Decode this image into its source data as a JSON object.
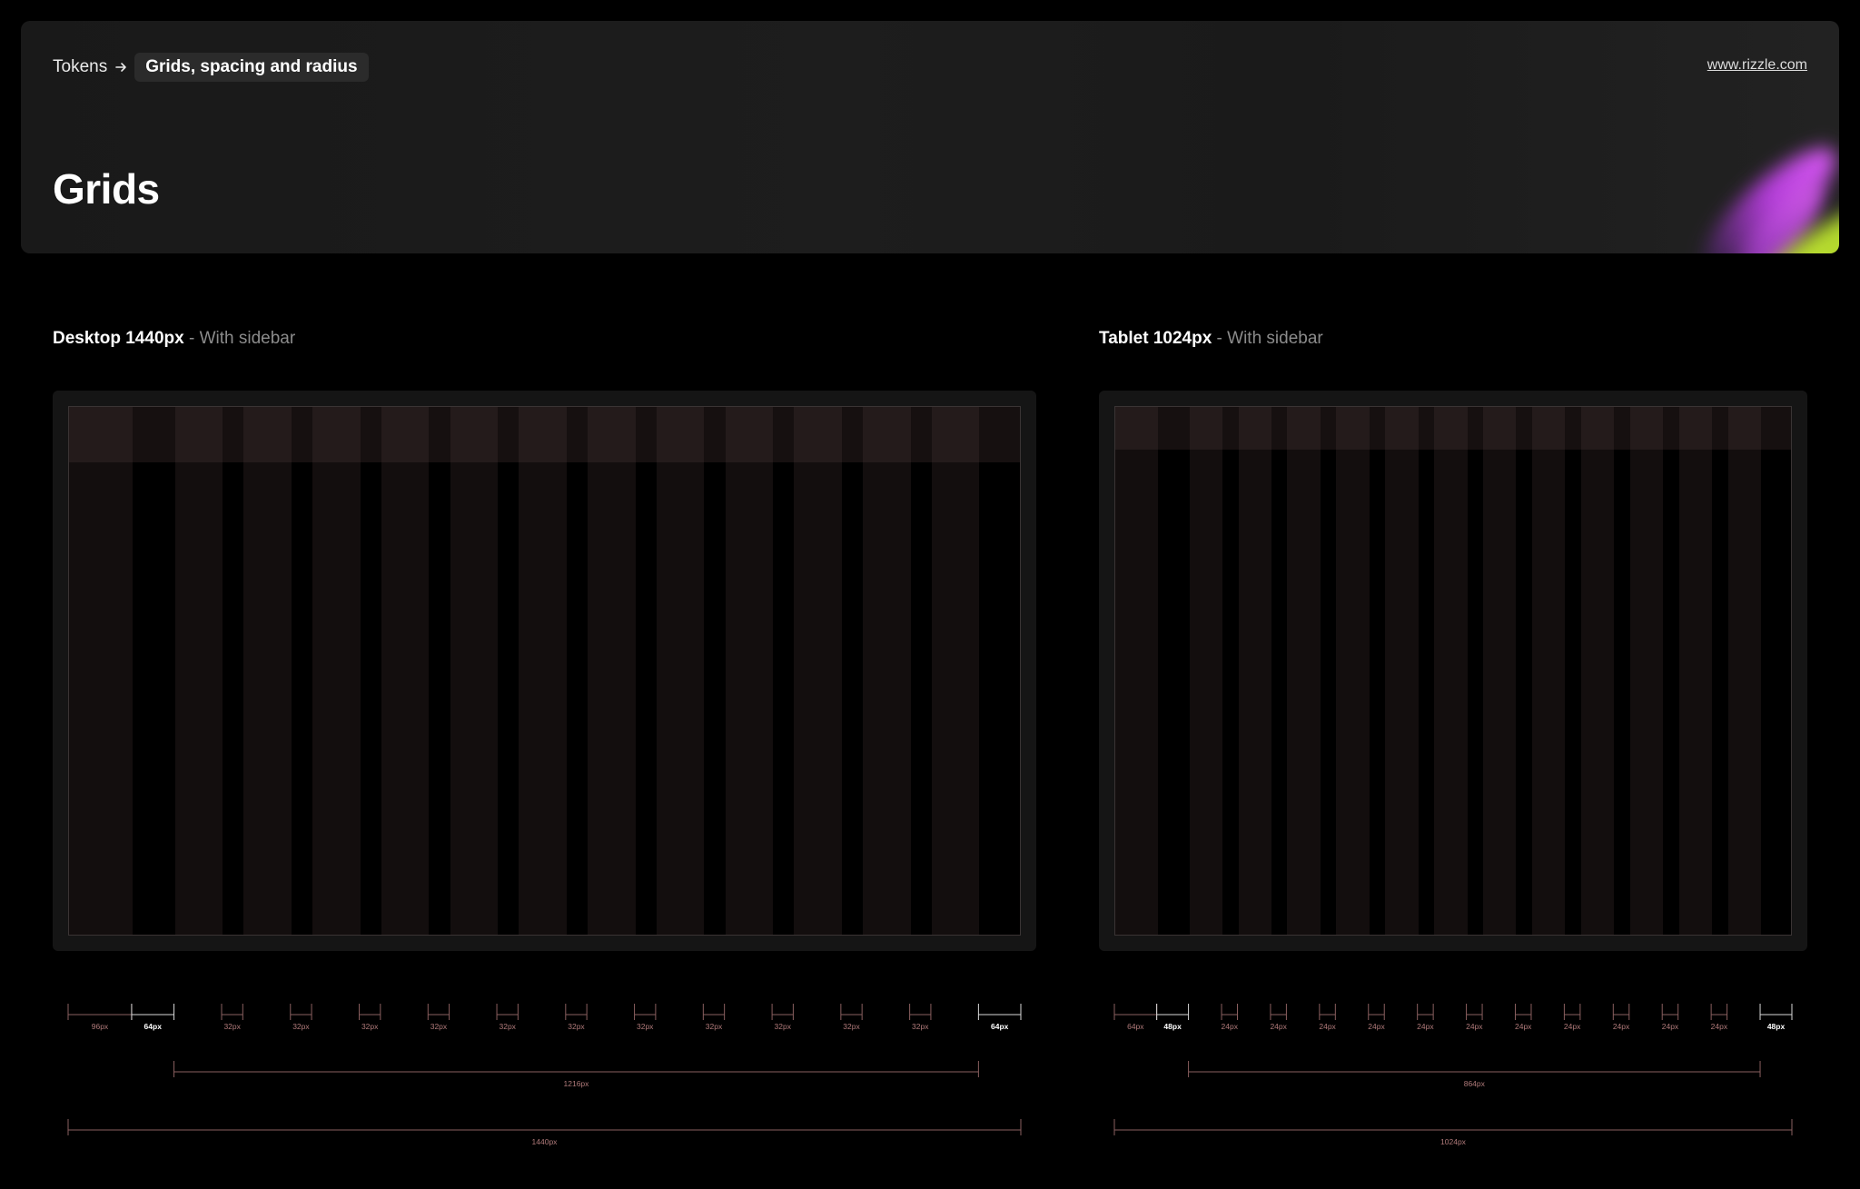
{
  "header": {
    "breadcrumb_root": "Tokens",
    "breadcrumb_current": "Grids, spacing and radius",
    "site_link": "www.rizzle.com",
    "title": "Grids"
  },
  "colors": {
    "background": "#000000",
    "header_bg": "#1b1b1b",
    "frame_bg": "#151515",
    "column_fill": "#130e0e",
    "topbar_fill": "#241b1b",
    "dimension_line": "#8a5f5f",
    "dimension_text": "#b07a7a",
    "accent_purple": "#c24de0",
    "accent_lime": "#b8dc2c"
  },
  "desktop": {
    "title": "Desktop 1440px",
    "subtitle": "- With sidebar",
    "frame_width": 1440,
    "sidebar": 96,
    "margin": 64,
    "gutter": 32,
    "columns": 12,
    "content_width": 1216,
    "sidebar_label": "96px",
    "margin_label": "64px",
    "gutter_label": "32px",
    "content_label": "1216px",
    "total_label": "1440px"
  },
  "tablet": {
    "title": "Tablet 1024px",
    "subtitle": "- With sidebar",
    "frame_width": 1024,
    "sidebar": 64,
    "margin": 48,
    "gutter": 24,
    "columns": 12,
    "content_width": 864,
    "sidebar_label": "64px",
    "margin_label": "48px",
    "gutter_label": "24px",
    "content_label": "864px",
    "total_label": "1024px"
  }
}
